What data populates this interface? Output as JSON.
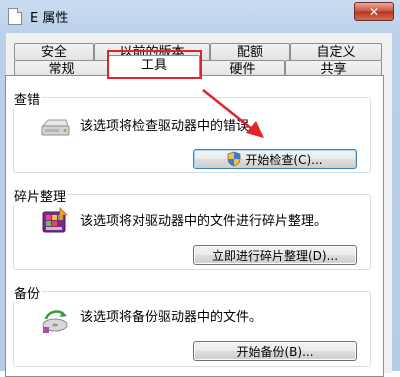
{
  "window": {
    "title": "E 属性",
    "close_glyph": "✕"
  },
  "tabs_row1": [
    "安全",
    "以前的版本",
    "配额",
    "自定义"
  ],
  "tabs_row2": [
    "常规",
    "工具",
    "硬件",
    "共享"
  ],
  "active_tab": "工具",
  "sections": {
    "check": {
      "label": "查错",
      "description": "该选项将检查驱动器中的错误。",
      "button": "开始检查(C)..."
    },
    "defrag": {
      "label": "碎片整理",
      "description": "该选项将对驱动器中的文件进行碎片整理。",
      "button": "立即进行碎片整理(D)..."
    },
    "backup": {
      "label": "备份",
      "description": "该选项将备份驱动器中的文件。",
      "button": "开始备份(B)..."
    }
  },
  "annotation": {
    "color": "#e3232b"
  }
}
